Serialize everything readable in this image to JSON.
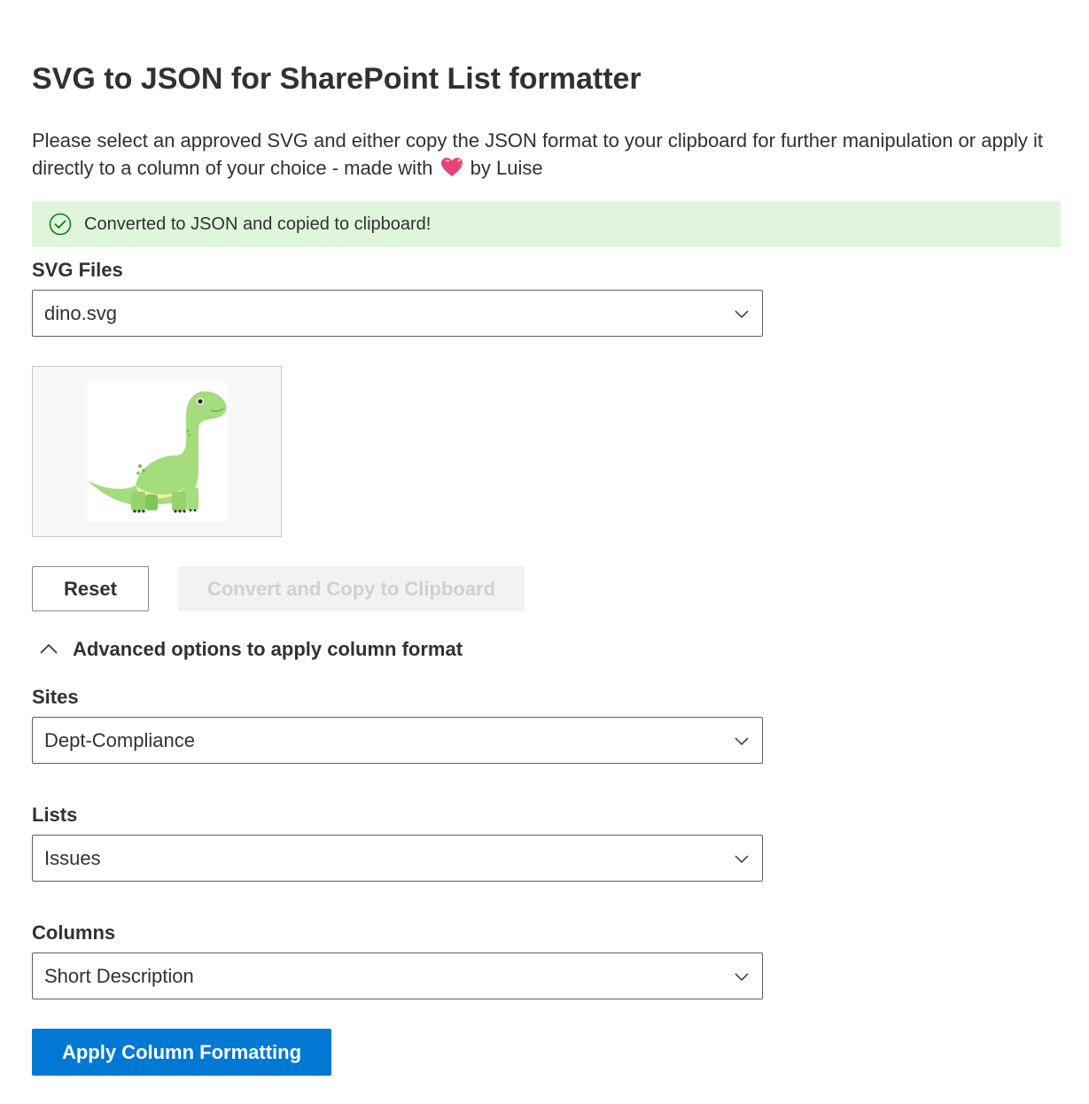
{
  "page": {
    "title": "SVG to JSON for SharePoint List formatter",
    "description_before": "Please select an approved SVG and either copy the JSON format to your clipboard for further manipulation or apply it directly to a column of your choice - made with",
    "description_after": "by Luise"
  },
  "message": {
    "icon": "check-circle-icon",
    "text": "Converted to JSON and copied to clipboard!",
    "background": "#dff6dd",
    "icon_color": "#107c10"
  },
  "svg_files": {
    "label": "SVG Files",
    "selected": "dino.svg"
  },
  "preview": {
    "image": "dinosaur-image"
  },
  "buttons": {
    "reset": "Reset",
    "convert": "Convert and Copy to Clipboard",
    "apply": "Apply Column Formatting"
  },
  "advanced": {
    "label": "Advanced options to apply column format",
    "expanded": true
  },
  "sites": {
    "label": "Sites",
    "selected": "Dept-Compliance"
  },
  "lists": {
    "label": "Lists",
    "selected": "Issues"
  },
  "columns": {
    "label": "Columns",
    "selected": "Short Description"
  },
  "colors": {
    "primary": "#0078d4",
    "text": "#323130",
    "disabled_bg": "#f3f2f1",
    "disabled_text": "#d2d0ce",
    "heart": "#e8437a"
  }
}
